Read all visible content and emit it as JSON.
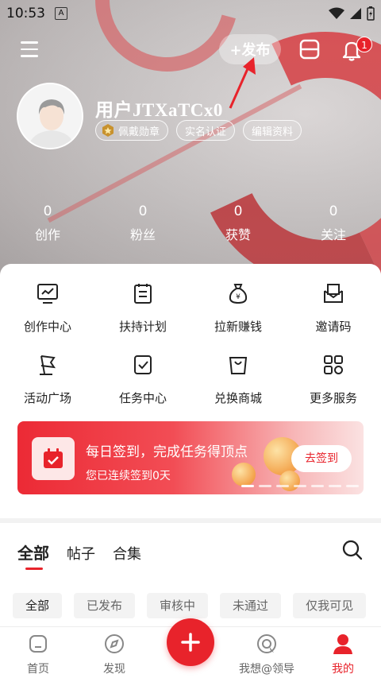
{
  "status_bar": {
    "time": "10:53",
    "notification_glyph": "A"
  },
  "header": {
    "publish_label": "+发布",
    "notification_count": "1"
  },
  "profile": {
    "username": "用户JTXaTCx0",
    "tags": [
      "佩戴勋章",
      "实名认证",
      "编辑资料"
    ]
  },
  "stats": [
    {
      "value": "0",
      "label": "创作"
    },
    {
      "value": "0",
      "label": "粉丝"
    },
    {
      "value": "0",
      "label": "获赞"
    },
    {
      "value": "0",
      "label": "关注"
    }
  ],
  "grid": [
    {
      "label": "创作中心",
      "icon": "monitor-chart-icon"
    },
    {
      "label": "扶持计划",
      "icon": "clipboard-icon"
    },
    {
      "label": "拉新赚钱",
      "icon": "money-bag-icon"
    },
    {
      "label": "邀请码",
      "icon": "envelope-icon"
    },
    {
      "label": "活动广场",
      "icon": "flag-icon"
    },
    {
      "label": "任务中心",
      "icon": "task-check-icon"
    },
    {
      "label": "兑换商城",
      "icon": "shopping-bag-icon"
    },
    {
      "label": "更多服务",
      "icon": "apps-grid-icon"
    }
  ],
  "banner": {
    "title": "每日签到，完成任务得顶点",
    "subtitle": "您已连续签到0天",
    "button": "去签到"
  },
  "posts": {
    "tabs": [
      "全部",
      "帖子",
      "合集"
    ],
    "filters": [
      "全部",
      "已发布",
      "审核中",
      "未通过",
      "仅我可见"
    ]
  },
  "bottom_nav": {
    "items": [
      "首页",
      "发现",
      "我想@领导",
      "我的"
    ]
  },
  "colors": {
    "accent": "#e8232b"
  }
}
